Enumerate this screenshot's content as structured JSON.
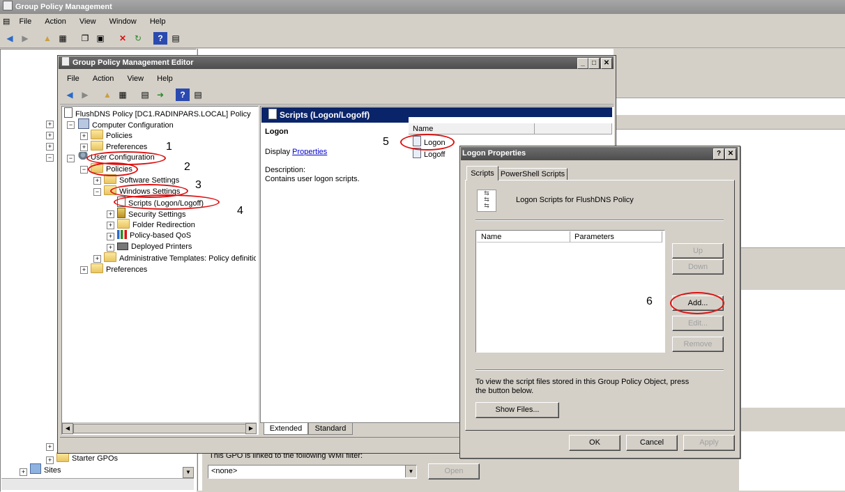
{
  "outer": {
    "title": "Group Policy Management",
    "menu": [
      "File",
      "Action",
      "View",
      "Window",
      "Help"
    ],
    "tree_bottom": [
      "Starter GPOs",
      "Sites"
    ],
    "wmi_label": "This GPO is linked to the following WMI filter:",
    "wmi_value": "<none>",
    "open_button": "Open"
  },
  "editor": {
    "title": "Group Policy Management Editor",
    "menu": [
      "File",
      "Action",
      "View",
      "Help"
    ],
    "tree": {
      "root": "FlushDNS Policy [DC1.RADINPARS.LOCAL] Policy",
      "computer_config": "Computer Configuration",
      "cc_policies": "Policies",
      "cc_preferences": "Preferences",
      "user_config": "User Configuration",
      "uc_policies": "Policies",
      "software_settings": "Software Settings",
      "windows_settings": "Windows Settings",
      "scripts": "Scripts (Logon/Logoff)",
      "security_settings": "Security Settings",
      "folder_redirection": "Folder Redirection",
      "policy_qos": "Policy-based QoS",
      "deployed_printers": "Deployed Printers",
      "admin_templates": "Administrative Templates: Policy definitior",
      "uc_preferences": "Preferences"
    },
    "details": {
      "header": "Scripts (Logon/Logoff)",
      "item_title": "Logon",
      "display_label": "Display",
      "display_link": "Properties",
      "description_label": "Description:",
      "description_text": "Contains user logon scripts."
    },
    "list": {
      "column": "Name",
      "items": [
        "Logon",
        "Logoff"
      ]
    },
    "tabs": [
      "Extended",
      "Standard"
    ]
  },
  "dialog": {
    "title": "Logon Properties",
    "tabs": [
      "Scripts",
      "PowerShell Scripts"
    ],
    "heading": "Logon Scripts for FlushDNS Policy",
    "columns": [
      "Name",
      "Parameters"
    ],
    "buttons": {
      "up": "Up",
      "down": "Down",
      "add": "Add...",
      "edit": "Edit...",
      "remove": "Remove",
      "show_files": "Show Files...",
      "ok": "OK",
      "cancel": "Cancel",
      "apply": "Apply"
    },
    "info_text": "To view the script files stored in this Group Policy Object, press the button below."
  },
  "annotations": [
    "1",
    "2",
    "3",
    "4",
    "5",
    "6"
  ],
  "colors": {
    "annotation_red": "#dd1111",
    "link_blue": "#0000cc",
    "header_bar": "#0a246a"
  }
}
